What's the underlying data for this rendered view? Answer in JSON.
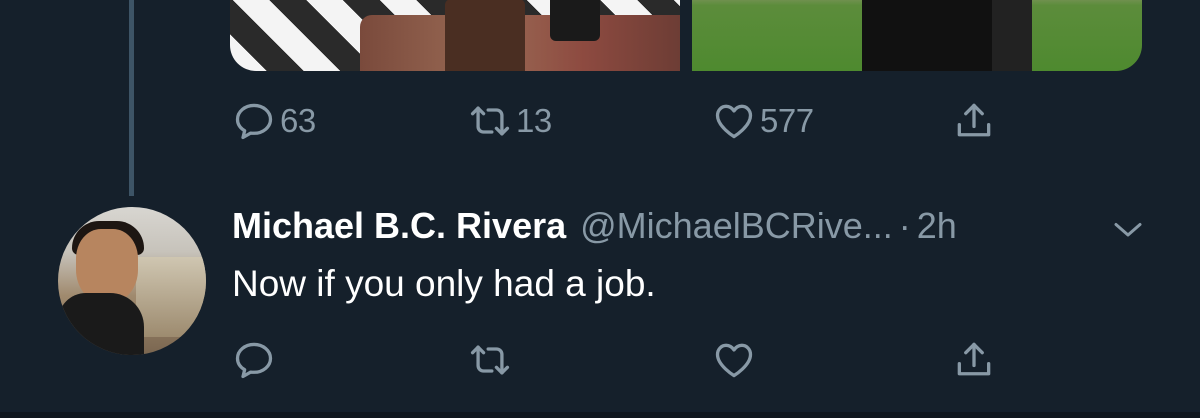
{
  "previous_tweet": {
    "media": [
      "photo-interior",
      "photo-lawn"
    ],
    "actions": {
      "reply_count": "63",
      "retweet_count": "13",
      "like_count": "577"
    }
  },
  "reply_tweet": {
    "display_name": "Michael B.C. Rivera",
    "handle": "@MichaelBCRive...",
    "separator": "·",
    "time": "2h",
    "text": "Now if you only had a job.",
    "icons": [
      "reply-icon",
      "retweet-icon",
      "like-icon",
      "share-icon",
      "chevron-down-icon"
    ]
  },
  "colors": {
    "background": "#15202b",
    "secondary_text": "#8899a6",
    "thread_line": "#3d5466"
  }
}
